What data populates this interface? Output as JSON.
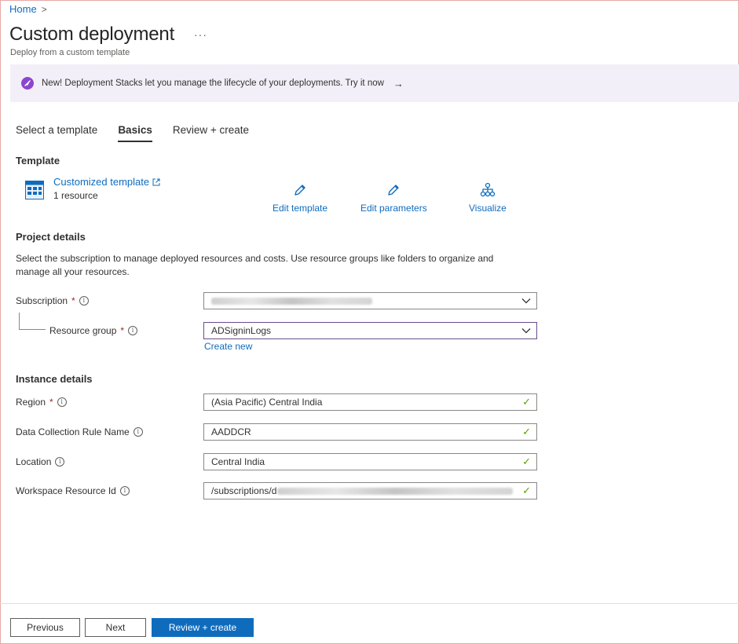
{
  "breadcrumb": {
    "home": "Home",
    "separator": ">"
  },
  "header": {
    "title": "Custom deployment",
    "more": "···",
    "subtitle": "Deploy from a custom template"
  },
  "banner": {
    "text": "New! Deployment Stacks let you manage the lifecycle of your deployments. Try it now",
    "arrow": "→",
    "icon": "rocket-icon",
    "color": "#8a47ce"
  },
  "tabs": [
    {
      "label": "Select a template",
      "active": false
    },
    {
      "label": "Basics",
      "active": true
    },
    {
      "label": "Review + create",
      "active": false
    }
  ],
  "template": {
    "heading": "Template",
    "name": "Customized template",
    "count": "1 resource",
    "actions": [
      {
        "label": "Edit template",
        "icon": "pencil-icon"
      },
      {
        "label": "Edit parameters",
        "icon": "pencil-icon"
      },
      {
        "label": "Visualize",
        "icon": "hierarchy-icon"
      }
    ]
  },
  "project": {
    "heading": "Project details",
    "description": "Select the subscription to manage deployed resources and costs. Use resource groups like folders to organize and manage all your resources.",
    "subscription_label": "Subscription",
    "resource_group_label": "Resource group",
    "resource_group_value": "ADSigninLogs",
    "create_new": "Create new"
  },
  "instance": {
    "heading": "Instance details",
    "fields": [
      {
        "label": "Region",
        "required": true,
        "value": "(Asia Pacific) Central India"
      },
      {
        "label": "Data Collection Rule Name",
        "required": false,
        "value": "AADDCR"
      },
      {
        "label": "Location",
        "required": false,
        "value": "Central India"
      },
      {
        "label": "Workspace Resource Id",
        "required": false,
        "value": "/subscriptions/d"
      }
    ]
  },
  "required_mark": "*",
  "info_glyph": "i",
  "footer": {
    "previous": "Previous",
    "next": "Next",
    "review": "Review + create"
  },
  "colors": {
    "accent": "#0f6cbd",
    "success": "#57a300",
    "banner_bg": "#f3eff8"
  }
}
